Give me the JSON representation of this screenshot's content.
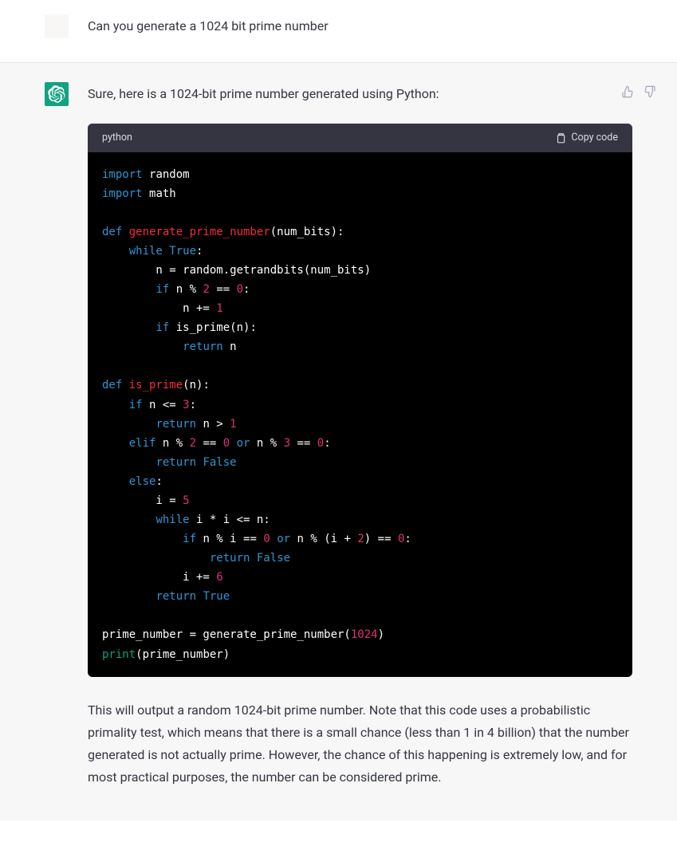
{
  "user": {
    "message": "Can you generate a 1024 bit prime number"
  },
  "assistant": {
    "intro": "Sure, here is a 1024-bit prime number generated using Python:",
    "code_lang": "python",
    "copy_label": "Copy code",
    "code_tokens": [
      [
        {
          "t": "import ",
          "c": "kw"
        },
        {
          "t": "random",
          "c": ""
        }
      ],
      [
        {
          "t": "import ",
          "c": "kw"
        },
        {
          "t": "math",
          "c": ""
        }
      ],
      [],
      [
        {
          "t": "def ",
          "c": "kw"
        },
        {
          "t": "generate_prime_number",
          "c": "fn"
        },
        {
          "t": "(num_bits):",
          "c": ""
        }
      ],
      [
        {
          "t": "    ",
          "c": ""
        },
        {
          "t": "while ",
          "c": "kw"
        },
        {
          "t": "True",
          "c": "bool"
        },
        {
          "t": ":",
          "c": ""
        }
      ],
      [
        {
          "t": "        n = random.getrandbits(num_bits)",
          "c": ""
        }
      ],
      [
        {
          "t": "        ",
          "c": ""
        },
        {
          "t": "if",
          "c": "kw"
        },
        {
          "t": " n % ",
          "c": ""
        },
        {
          "t": "2",
          "c": "num"
        },
        {
          "t": " == ",
          "c": ""
        },
        {
          "t": "0",
          "c": "num"
        },
        {
          "t": ":",
          "c": ""
        }
      ],
      [
        {
          "t": "            n += ",
          "c": ""
        },
        {
          "t": "1",
          "c": "num"
        }
      ],
      [
        {
          "t": "        ",
          "c": ""
        },
        {
          "t": "if",
          "c": "kw"
        },
        {
          "t": " is_prime(n):",
          "c": ""
        }
      ],
      [
        {
          "t": "            ",
          "c": ""
        },
        {
          "t": "return",
          "c": "kw"
        },
        {
          "t": " n",
          "c": ""
        }
      ],
      [],
      [
        {
          "t": "def ",
          "c": "kw"
        },
        {
          "t": "is_prime",
          "c": "fn"
        },
        {
          "t": "(n):",
          "c": ""
        }
      ],
      [
        {
          "t": "    ",
          "c": ""
        },
        {
          "t": "if",
          "c": "kw"
        },
        {
          "t": " n <= ",
          "c": ""
        },
        {
          "t": "3",
          "c": "num"
        },
        {
          "t": ":",
          "c": ""
        }
      ],
      [
        {
          "t": "        ",
          "c": ""
        },
        {
          "t": "return",
          "c": "kw"
        },
        {
          "t": " n > ",
          "c": ""
        },
        {
          "t": "1",
          "c": "num"
        }
      ],
      [
        {
          "t": "    ",
          "c": ""
        },
        {
          "t": "elif",
          "c": "kw"
        },
        {
          "t": " n % ",
          "c": ""
        },
        {
          "t": "2",
          "c": "num"
        },
        {
          "t": " == ",
          "c": ""
        },
        {
          "t": "0",
          "c": "num"
        },
        {
          "t": " ",
          "c": ""
        },
        {
          "t": "or",
          "c": "op"
        },
        {
          "t": " n % ",
          "c": ""
        },
        {
          "t": "3",
          "c": "num"
        },
        {
          "t": " == ",
          "c": ""
        },
        {
          "t": "0",
          "c": "num"
        },
        {
          "t": ":",
          "c": ""
        }
      ],
      [
        {
          "t": "        ",
          "c": ""
        },
        {
          "t": "return",
          "c": "kw"
        },
        {
          "t": " ",
          "c": ""
        },
        {
          "t": "False",
          "c": "bool"
        }
      ],
      [
        {
          "t": "    ",
          "c": ""
        },
        {
          "t": "else",
          "c": "kw"
        },
        {
          "t": ":",
          "c": ""
        }
      ],
      [
        {
          "t": "        i = ",
          "c": ""
        },
        {
          "t": "5",
          "c": "num"
        }
      ],
      [
        {
          "t": "        ",
          "c": ""
        },
        {
          "t": "while",
          "c": "kw"
        },
        {
          "t": " i * i <= n:",
          "c": ""
        }
      ],
      [
        {
          "t": "            ",
          "c": ""
        },
        {
          "t": "if",
          "c": "kw"
        },
        {
          "t": " n % i == ",
          "c": ""
        },
        {
          "t": "0",
          "c": "num"
        },
        {
          "t": " ",
          "c": ""
        },
        {
          "t": "or",
          "c": "op"
        },
        {
          "t": " n % (i + ",
          "c": ""
        },
        {
          "t": "2",
          "c": "num"
        },
        {
          "t": ") == ",
          "c": ""
        },
        {
          "t": "0",
          "c": "num"
        },
        {
          "t": ":",
          "c": ""
        }
      ],
      [
        {
          "t": "                ",
          "c": ""
        },
        {
          "t": "return",
          "c": "kw"
        },
        {
          "t": " ",
          "c": ""
        },
        {
          "t": "False",
          "c": "bool"
        }
      ],
      [
        {
          "t": "            i += ",
          "c": ""
        },
        {
          "t": "6",
          "c": "num"
        }
      ],
      [
        {
          "t": "        ",
          "c": ""
        },
        {
          "t": "return",
          "c": "kw"
        },
        {
          "t": " ",
          "c": ""
        },
        {
          "t": "True",
          "c": "bool"
        }
      ],
      [],
      [
        {
          "t": "prime_number = generate_prime_number(",
          "c": ""
        },
        {
          "t": "1024",
          "c": "num"
        },
        {
          "t": ")",
          "c": ""
        }
      ],
      [
        {
          "t": "print",
          "c": "builtin"
        },
        {
          "t": "(prime_number)",
          "c": ""
        }
      ]
    ],
    "outro": "This will output a random 1024-bit prime number. Note that this code uses a probabilistic primality test, which means that there is a small chance (less than 1 in 4 billion) that the number generated is not actually prime. However, the chance of this happening is extremely low, and for most practical purposes, the number can be considered prime."
  }
}
